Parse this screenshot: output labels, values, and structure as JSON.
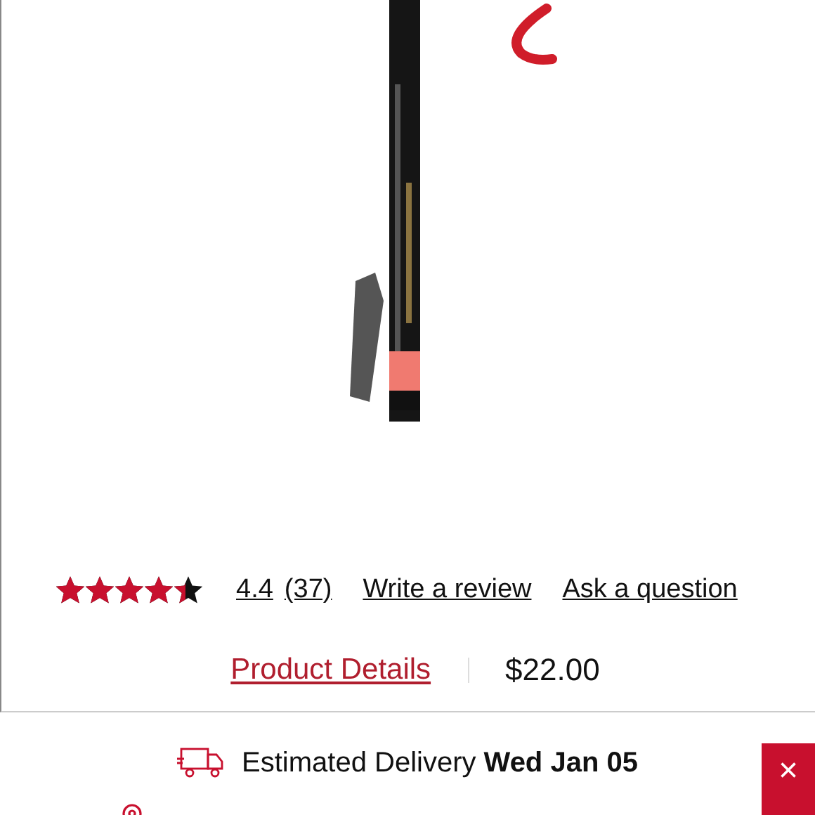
{
  "rating": {
    "stars": 4.4,
    "score": "4.4",
    "count": "(37)"
  },
  "links": [
    "Write a review",
    "Ask a question"
  ],
  "details_link": "Product Details",
  "price": "$22.00",
  "delivery": {
    "label": "Estimated Delivery",
    "date": "Wed Jan 05"
  },
  "close_button": "×"
}
